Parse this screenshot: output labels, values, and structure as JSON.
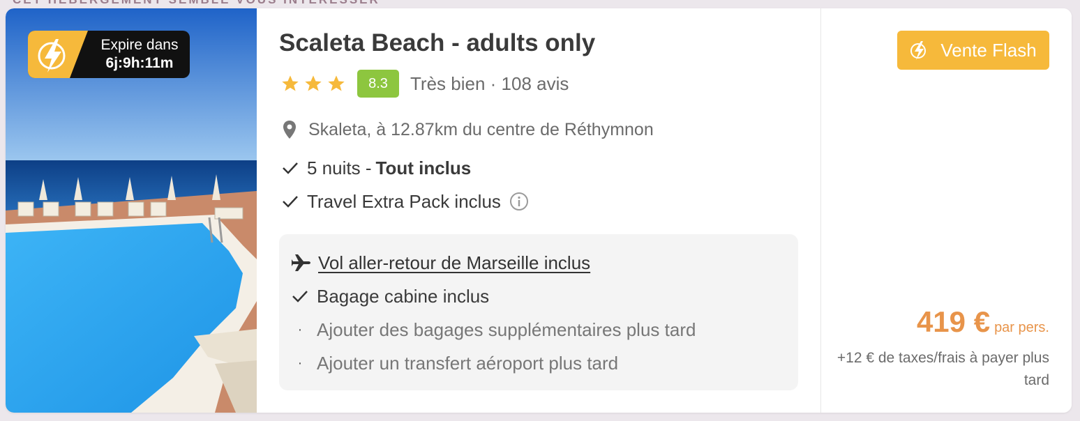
{
  "top_strip": {
    "text": "CET HÉBERGEMENT SEMBLE VOUS INTÉRESSER"
  },
  "offer": {
    "expire_label": "Expire dans",
    "expire_time": "6j:9h:11m",
    "hotel_name": "Scaleta Beach - adults only",
    "star_count": 3,
    "score": "8.3",
    "review_text": "Très bien · 108 avis",
    "location": "Skaleta, à 12.87km du centre de Réthymnon",
    "features": {
      "nights": "5 nuits - ",
      "board": "Tout inclus",
      "pack": "Travel Extra Pack inclus"
    },
    "flight": {
      "title": "Vol aller-retour de Marseille inclus",
      "cabin": "Bagage cabine inclus",
      "extra_bags": "Ajouter des bagages supplémentaires plus tard",
      "transfer": "Ajouter un transfert aéroport plus tard"
    }
  },
  "price_panel": {
    "flash_label": "Vente Flash",
    "price": "419 €",
    "unit": "par pers.",
    "tax_note": "+12 € de taxes/frais à payer plus tard"
  },
  "colors": {
    "accent_orange": "#e8944a",
    "flash_yellow": "#f6b93b",
    "score_green": "#8dc63f"
  },
  "icons": [
    "flash-icon",
    "star-icon",
    "location-pin-icon",
    "check-icon",
    "info-icon",
    "plane-icon"
  ]
}
